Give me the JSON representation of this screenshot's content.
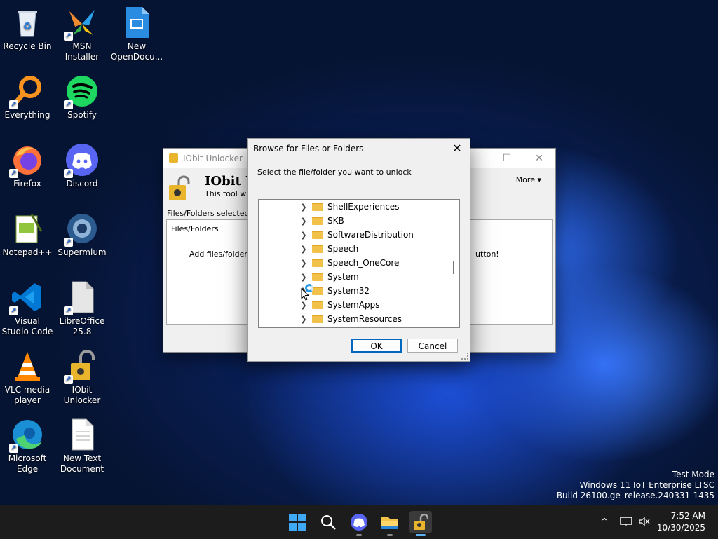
{
  "desktop": {
    "icons": [
      {
        "label": "Recycle Bin"
      },
      {
        "label": "MSN Installer"
      },
      {
        "label": "New OpenDocu..."
      },
      {
        "label": "Everything"
      },
      {
        "label": "Spotify"
      },
      {
        "label": "Firefox"
      },
      {
        "label": "Discord"
      },
      {
        "label": "Notepad++"
      },
      {
        "label": "Supermium"
      },
      {
        "label": "Visual Studio Code"
      },
      {
        "label": "LibreOffice 25.8"
      },
      {
        "label": "VLC media player"
      },
      {
        "label": "IObit Unlocker"
      },
      {
        "label": "Microsoft Edge"
      },
      {
        "label": "New Text Document"
      }
    ]
  },
  "iobit": {
    "title": "IObit Unlocker",
    "app_name": "IObit Ur",
    "subtitle": "This tool will l",
    "more": "More",
    "selected_label": "Files/Folders selected",
    "column_header": "Files/Folders",
    "hint": "Add files/folders t",
    "hint_tail": "utton!"
  },
  "dialog": {
    "title": "Browse for Files or Folders",
    "prompt": "Select the file/folder you want to unlock",
    "items": [
      "ShellExperiences",
      "SKB",
      "SoftwareDistribution",
      "Speech",
      "Speech_OneCore",
      "System",
      "System32",
      "SystemApps",
      "SystemResources"
    ],
    "ok": "OK",
    "cancel": "Cancel"
  },
  "watermark": {
    "line1": "Test Mode",
    "line2": "Windows 11 IoT Enterprise LTSC",
    "line3": "Build 26100.ge_release.240331-1435"
  },
  "clock": {
    "time": "7:52 AM",
    "date": "10/30/2025"
  },
  "colors": {
    "accent": "#0067c0",
    "folder": "#f2c14a"
  }
}
